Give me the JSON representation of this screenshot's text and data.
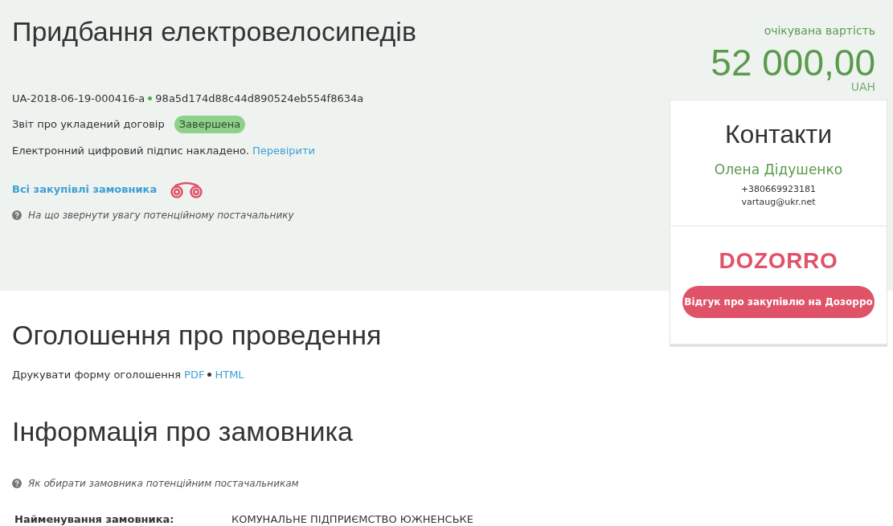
{
  "header": {
    "title": "Придбання електровелосипедів",
    "id": "UA-2018-06-19-000416-a",
    "hash": "98a5d174d88c44d890524eb554f8634a",
    "report_label": "Звіт про укладений договір",
    "status": {
      "label": "Завершена",
      "kind": "complete"
    },
    "signature_text": "Електронний цифровий підпис накладено.",
    "signature_link": "Перевірити",
    "buyer_link": "Всі закупівлі замовника",
    "hint": "На що звернути увагу потенційному постачальнику"
  },
  "value": {
    "label": "очікувана вартість",
    "amount": "52 000,00",
    "currency": "UAH"
  },
  "contacts": {
    "title": "Контакти",
    "name": "Олена Дідушенко",
    "phone": "+380669923181",
    "email": "vartaug@ukr.net",
    "logo": "DOZORRO",
    "button": "Відгук про закупівлю на Дозорро"
  },
  "announcement": {
    "title": "Оголошення про проведення",
    "print_label": "Друкувати форму оголошення",
    "links": [
      "PDF",
      "HTML"
    ]
  },
  "buyer": {
    "title": "Інформація про замовника",
    "hint": "Як обирати замовника потенційним постачальникам",
    "fields": [
      {
        "label": "Найменування замовника:",
        "value": "КОМУНАЛЬНЕ ПІДПРИЄМСТВО ЮЖНЕНСЬКЕ"
      }
    ]
  }
}
